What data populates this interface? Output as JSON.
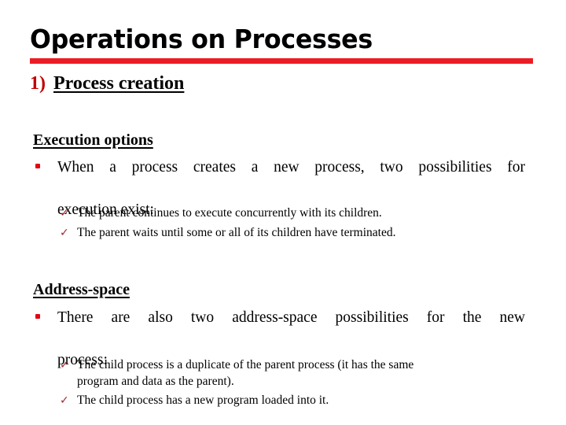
{
  "slide": {
    "title": "Operations on Processes",
    "accent_color": "#ED1C24",
    "bullet_color": "#E30613",
    "check_color": "#A02833",
    "number_color": "#C00000",
    "background_color": "#FFFFFF"
  },
  "heading": {
    "number": "1)",
    "text": "Process creation"
  },
  "sections": [
    {
      "heading": "Execution options",
      "bullet": {
        "marker": "square-bullet",
        "line1": "When a process creates a new process, two possibilities for",
        "line2": "execution exist:"
      },
      "checks": [
        {
          "marker": "check-mark",
          "line1": "The parent continues to execute concurrently with its children.",
          "line2": ""
        },
        {
          "marker": "check-mark",
          "line1": "The parent waits until some or all of its children have terminated.",
          "line2": ""
        }
      ]
    },
    {
      "heading": "Address-space",
      "bullet": {
        "marker": "square-bullet",
        "line1": "There are also two address-space possibilities for the new",
        "line2": "process:"
      },
      "checks": [
        {
          "marker": "check-mark",
          "line1": "The child process is a duplicate of the parent process (it has the same",
          "line2": "program and data as the parent)."
        },
        {
          "marker": "check-mark",
          "line1": "The child process has a new program loaded into it.",
          "line2": ""
        }
      ]
    }
  ],
  "glyphs": {
    "check": "✓"
  }
}
